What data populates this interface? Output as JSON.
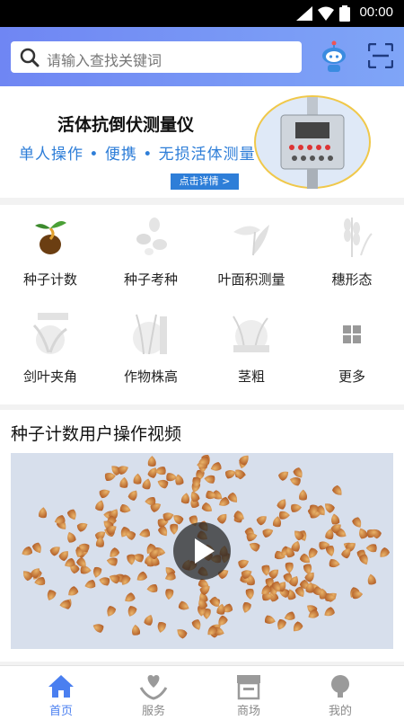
{
  "status_bar": {
    "time": "00:00"
  },
  "search": {
    "placeholder": "请输入查找关键词"
  },
  "banner": {
    "title": "活体抗倒伏测量仪",
    "subtitle": "单人操作 • 便携 • 无损活体测量",
    "button": "点击详情 >"
  },
  "features": [
    {
      "label": "种子计数",
      "icon": "seed-sprout-icon"
    },
    {
      "label": "种子考种",
      "icon": "seeds-icon"
    },
    {
      "label": "叶面积测量",
      "icon": "leaf-icon"
    },
    {
      "label": "穗形态",
      "icon": "wheat-ear-icon"
    },
    {
      "label": "剑叶夹角",
      "icon": "flag-leaf-angle-icon"
    },
    {
      "label": "作物株高",
      "icon": "plant-height-icon"
    },
    {
      "label": "茎粗",
      "icon": "stem-diameter-icon"
    },
    {
      "label": "更多",
      "icon": "more-grid-icon"
    }
  ],
  "video": {
    "title": "种子计数用户操作视频"
  },
  "tabs": [
    {
      "label": "首页",
      "icon": "home-icon",
      "active": true
    },
    {
      "label": "服务",
      "icon": "service-heart-hand-icon",
      "active": false
    },
    {
      "label": "商场",
      "icon": "shop-icon",
      "active": false
    },
    {
      "label": "我的",
      "icon": "profile-icon",
      "active": false
    }
  ],
  "colors": {
    "accent": "#4a7ff0",
    "header_start": "#6f86f3",
    "header_end": "#7fa5f7",
    "banner_blue": "#2e7ed8"
  }
}
